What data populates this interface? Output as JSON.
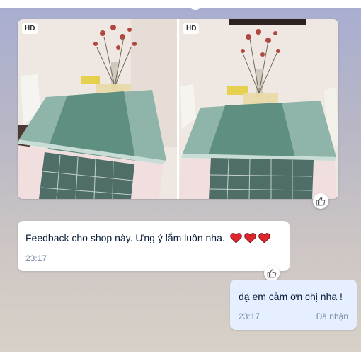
{
  "photo_message": {
    "photos": [
      {
        "badge": "HD"
      },
      {
        "badge": "HD"
      }
    ]
  },
  "incoming_message": {
    "text": "Feedback cho shop này. Ưng ý lắm luôn nha.",
    "emoji": [
      "heart",
      "heart",
      "heart"
    ],
    "time": "23:17"
  },
  "outgoing_message": {
    "text": "dạ em cảm ơn chị nha !",
    "time": "23:17",
    "status": "Đã nhận"
  },
  "colors": {
    "outgoing_bubble": "#e5efff",
    "heart": "#e0262c",
    "time_text": "#7589a3"
  },
  "icons": [
    "thumbs-up-icon",
    "heart-icon"
  ]
}
